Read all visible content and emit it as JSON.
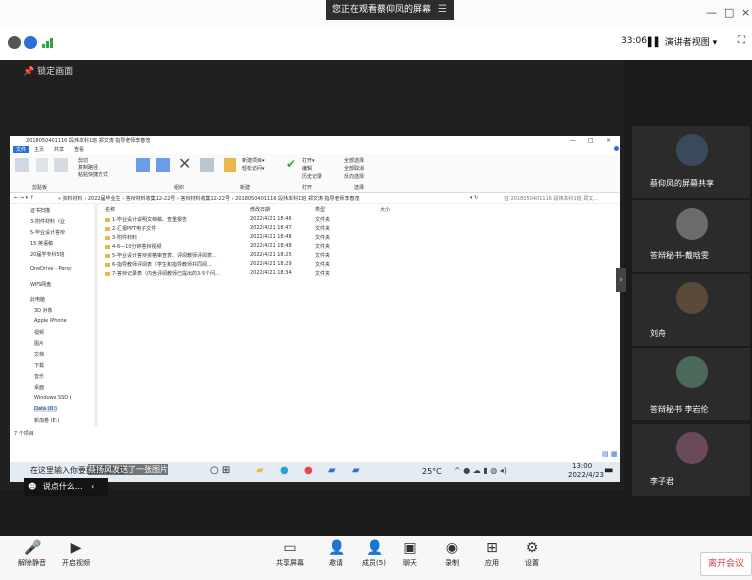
{
  "meeting": {
    "banner": "您正在观看蔡仰凤的屏幕",
    "banner_icon": "☰",
    "timer": "33:06",
    "view_label": "演讲者视图",
    "lock_label": "锁定画面",
    "chat_placeholder": "说点什么...",
    "chat_notice": "蔡扬凤发送了一张图片"
  },
  "window": {
    "minimize": "—",
    "maximize": "□",
    "close": "×"
  },
  "explorer": {
    "title": "2018050401116 段炜本科1班 郑文涛 指导老师李春茂",
    "menu": [
      "文件",
      "主页",
      "共享",
      "查看"
    ],
    "path": "« 资料材料 › 2022届毕业生 › 答辩材料收集12-22号 › 答辩材料收集12-22号 › 2018050401116 段炜本科1班 郑文涛 指导老师李春茂",
    "search": "在 2018050401116 段炜本科1班 郑文...",
    "ribbon_groups": [
      "剪贴板",
      "组织",
      "新建",
      "打开",
      "选择"
    ],
    "ribbon_buttons": [
      "固定到快速访问",
      "复制",
      "粘贴",
      "剪切",
      "复制路径",
      "粘贴快捷方式",
      "移动到",
      "复制到",
      "删除",
      "重命名",
      "新建文件夹",
      "新建项目▾",
      "轻松访问▾",
      "属性",
      "打开▾",
      "编辑",
      "历史记录",
      "全部选择",
      "全部取消",
      "反向选择"
    ],
    "columns": [
      "名称",
      "修改日期",
      "类型",
      "大小"
    ],
    "rows": [
      {
        "name": "1-毕业设计说明文档稿、查重报告",
        "date": "2022/4/21 18:46",
        "type": "文件夹"
      },
      {
        "name": "2-汇报PPT电子文件",
        "date": "2022/4/21 18:47",
        "type": "文件夹"
      },
      {
        "name": "3-附件材料",
        "date": "2022/4/21 18:48",
        "type": "文件夹"
      },
      {
        "name": "4-6—10分钟答辩视频",
        "date": "2022/4/21 18:48",
        "type": "文件夹"
      },
      {
        "name": "5-毕业设计答辩资格审查表、评阅教师评阅表...",
        "date": "2022/4/21 18:25",
        "type": "文件夹"
      },
      {
        "name": "6-指导教师评阅表（学生和指导教师共同阅...",
        "date": "2022/4/21 18:29",
        "type": "文件夹"
      },
      {
        "name": "7-答辩记录表（内含评阅教师已提出的3-5个问...",
        "date": "2022/4/21 18:34",
        "type": "文件夹"
      }
    ],
    "nav": [
      "证书扫描",
      "3-附件材料（业",
      "5-毕业设计答辩",
      "15.英语稿",
      "20届学专科5班",
      "OneDrive - Persc",
      "WPS网盘",
      "此电脑",
      "3D 对象",
      "Apple iPhone",
      "视频",
      "图片",
      "文档",
      "下载",
      "音乐",
      "桌面",
      "Windows SSD (",
      "Data (D:)",
      "新加卷 (E:)"
    ],
    "status": "7 个项目"
  },
  "taskbar": {
    "temp": "25°C",
    "time": "13:00",
    "date": "2022/4/23",
    "search": "在这里输入你要搜索的内容"
  },
  "participants": [
    {
      "name": "蔡仰凤的屏幕共享",
      "color": "#3a4a5a"
    },
    {
      "name": "答辩秘书-戴晗雯",
      "color": "#6b6b6b"
    },
    {
      "name": "刘舟",
      "color": "#5a4a3a"
    },
    {
      "name": "答辩秘书 李岩伦",
      "color": "#4a6a5a"
    },
    {
      "name": "李子君",
      "color": "#6a4a5a"
    }
  ],
  "toolbar": {
    "mute": "解除静音",
    "video": "开启视频",
    "share": "共享屏幕",
    "invite": "邀请",
    "members": "成员(5)",
    "chat": "聊天",
    "record": "录制",
    "apps": "应用",
    "settings": "设置",
    "leave": "离开会议"
  },
  "colors": {
    "accent": "#e43b3b",
    "folder": "#e8b94a",
    "link": "#2a6fd6"
  }
}
